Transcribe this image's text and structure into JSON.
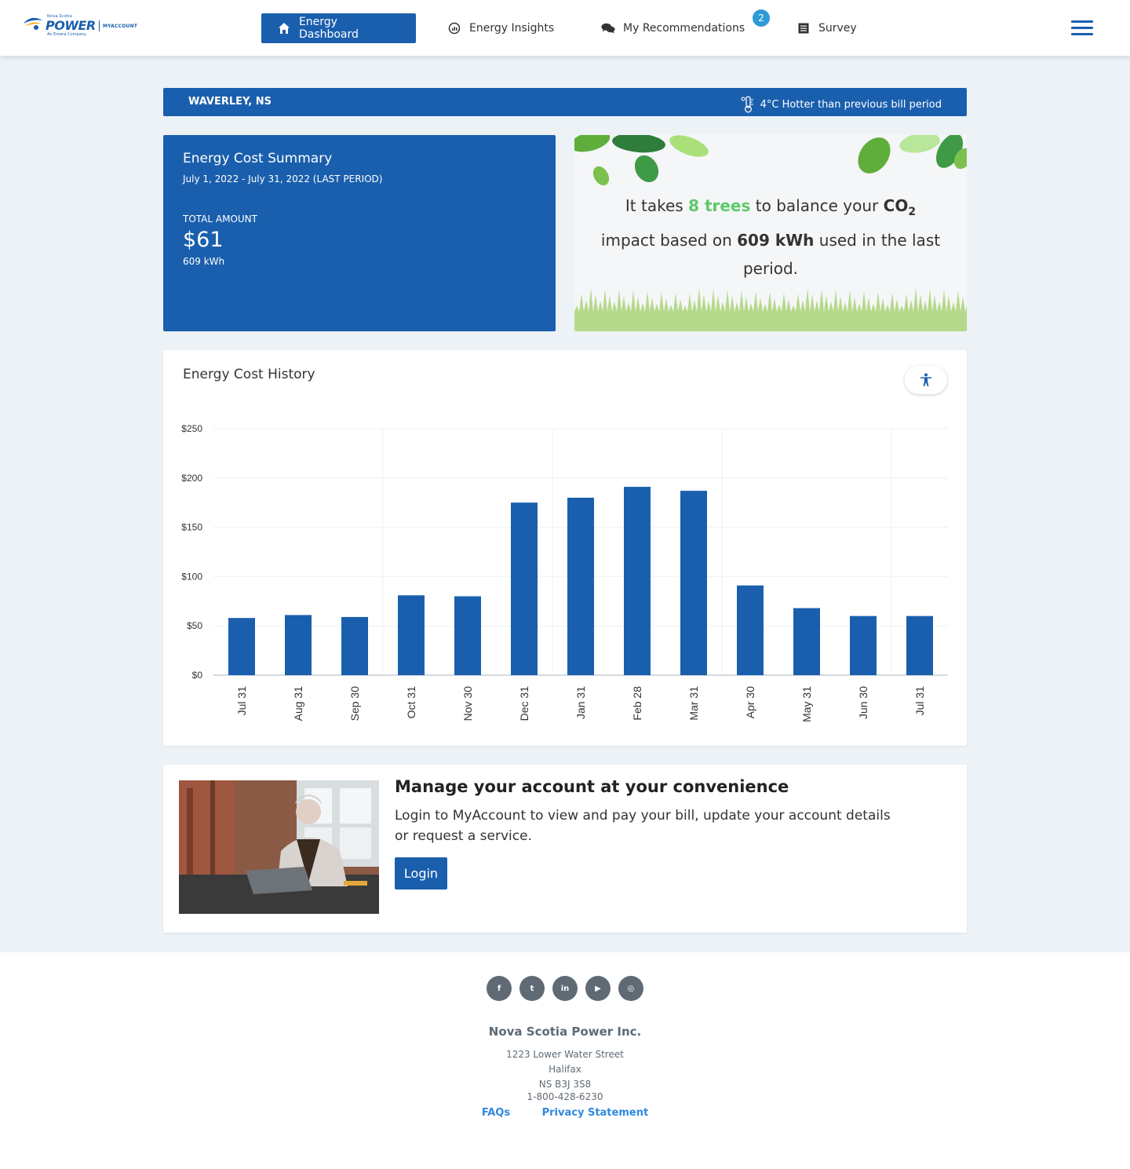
{
  "header": {
    "logo": {
      "top": "Nova Scotia",
      "brand": "POWER",
      "product": "MYACCOUNT",
      "tagline": "An Emera Company"
    },
    "nav": [
      {
        "label": "Energy Dashboard",
        "icon": "home-icon",
        "active": true
      },
      {
        "label": "Energy Insights",
        "icon": "insights-icon",
        "active": false
      },
      {
        "label": "My Recommendations",
        "icon": "chat-icon",
        "active": false,
        "badge": "2"
      },
      {
        "label": "Survey",
        "icon": "survey-icon",
        "active": false
      }
    ],
    "menu_icon": "hamburger-icon"
  },
  "location": {
    "place": "WAVERLEY, NS",
    "temperature_note": "4°C Hotter than previous bill period"
  },
  "cost_summary": {
    "title": "Energy Cost Summary",
    "period": "July 1, 2022 - July 31, 2022 (LAST PERIOD)",
    "total_label": "TOTAL AMOUNT",
    "amount": "$61",
    "usage": "609 kWh"
  },
  "trees": {
    "prefix": "It takes",
    "count": "8 trees",
    "middle": "to balance your",
    "co2": "CO",
    "co2_sub": "2",
    "line2_prefix": "impact based on",
    "kwh": "609 kWh",
    "suffix": "used in the last period."
  },
  "history": {
    "title": "Energy Cost History",
    "accessibility_icon": "accessibility-icon"
  },
  "chart_data": {
    "type": "bar",
    "title": "Energy Cost History",
    "categories": [
      "Jul 31",
      "Aug 31",
      "Sep 30",
      "Oct 31",
      "Nov 30",
      "Dec 31",
      "Jan 31",
      "Feb 28",
      "Mar 31",
      "Apr 30",
      "May 31",
      "Jun 30",
      "Jul 31"
    ],
    "values": [
      58,
      61,
      59,
      81,
      80,
      175,
      180,
      191,
      187,
      91,
      68,
      60,
      60
    ],
    "yticks": [
      "$0",
      "$50",
      "$100",
      "$150",
      "$200",
      "$250"
    ],
    "ylim": [
      0,
      250
    ],
    "grid": true,
    "color": "#1a5fad"
  },
  "account": {
    "heading": "Manage your account at your convenience",
    "description": "Login to MyAccount to view and pay your bill, update your account details or request a service.",
    "login_label": "Login"
  },
  "footer": {
    "socials": [
      {
        "icon": "facebook-icon",
        "glyph": "f"
      },
      {
        "icon": "twitter-icon",
        "glyph": "t"
      },
      {
        "icon": "linkedin-icon",
        "glyph": "in"
      },
      {
        "icon": "youtube-icon",
        "glyph": "▶"
      },
      {
        "icon": "instagram-icon",
        "glyph": "◎"
      }
    ],
    "company": "Nova Scotia Power Inc.",
    "street": "1223 Lower Water Street",
    "city": "Halifax",
    "postal": "NS B3J 3S8",
    "phone": "1-800-428-6230",
    "faqs": "FAQs",
    "privacy": "Privacy Statement"
  },
  "colors": {
    "primary": "#1a5fad",
    "background": "#ecf2f6",
    "green_accent": "#5cc96a",
    "badge": "#2e9ad8",
    "link": "#2e8ae0"
  }
}
